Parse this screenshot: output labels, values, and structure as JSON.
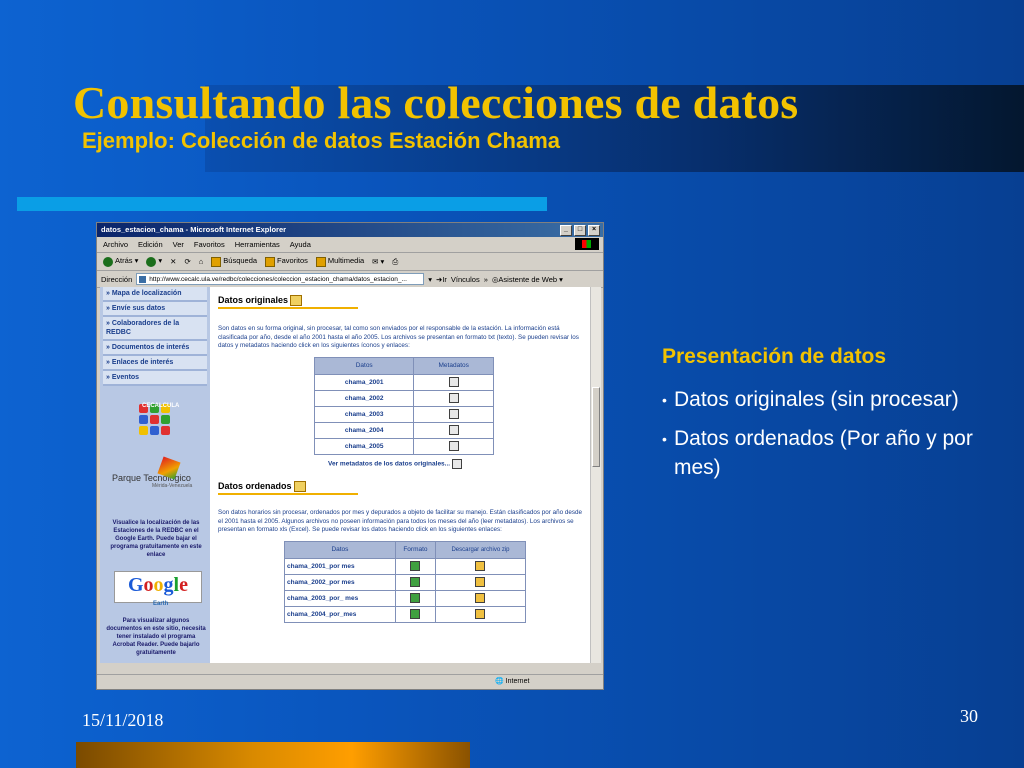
{
  "slide": {
    "title": "Consultando las colecciones de datos",
    "subtitle": "Ejemplo: Colección de datos Estación Chama",
    "date": "15/11/2018",
    "page_number": "30",
    "bullets_heading": "Presentación de datos",
    "bullets": [
      "Datos originales (sin procesar)",
      "Datos ordenados (Por año y por mes)"
    ],
    "colors": {
      "title": "#f2c200",
      "background": "#0a4fb0"
    }
  },
  "browser": {
    "window_title": "datos_estacion_chama - Microsoft Internet Explorer",
    "menu": [
      "Archivo",
      "Edición",
      "Ver",
      "Favoritos",
      "Herramientas",
      "Ayuda"
    ],
    "toolbar": {
      "back": "Atrás",
      "search": "Búsqueda",
      "favorites": "Favoritos",
      "multimedia": "Multimedia"
    },
    "address_label": "Dirección",
    "address": "http://www.cecalc.ula.ve/redbc/colecciones/coleccion_estacion_chama/datos_estacion_...",
    "go": "Ir",
    "links": "Vínculos",
    "web_assistant": "Asistente de Web",
    "status": "Internet"
  },
  "sidebar": {
    "items": [
      "Mapa de localización",
      "Envíe sus datos",
      "Colaboradores de la REDBC",
      "Documentos de interés",
      "Enlaces de interés",
      "Eventos"
    ],
    "logo_label": "CECALCULA",
    "park_name": "Parque Tecnológico",
    "park_sub": "Mérida-Venezuela",
    "google_earth_text": "Visualice la localización de las Estaciones de la REDBC en el Google Earth. Puede bajar el programa gratuitamente en este enlace",
    "google_earth_logo": "Google",
    "google_earth_sub": "Earth",
    "acrobat_text": "Para visualizar algunos documentos en este sitio, necesita tener instalado el programa Acrobat Reader. Puede bajarlo gratuitamente"
  },
  "content": {
    "originales": {
      "heading": "Datos originales",
      "text": "Son datos en su forma original, sin procesar, tal como son enviados por el responsable de la estación. La información está clasificada por año, desde el año 2001 hasta el año 2005. Los archivos se presentan en formato txt (texto). Se pueden revisar los datos y metadatos haciendo click en los siguientes íconos y enlaces:",
      "columns": [
        "Datos",
        "Metadatos"
      ],
      "rows": [
        "chama_2001",
        "chama_2002",
        "chama_2003",
        "chama_2004",
        "chama_2005"
      ],
      "metadata_link": "Ver metadatos de los datos originales..."
    },
    "ordenados": {
      "heading": "Datos ordenados",
      "text": "Son datos horarios sin procesar, ordenados por mes y depurados a objeto de facilitar su manejo. Están clasificados por año desde el 2001 hasta el 2005. Algunos archivos no poseen información para todos los meses del año (leer metadatos). Los archivos se presentan en formato xls (Excel). Se puede revisar los datos haciendo click en los siguientes enlaces:",
      "columns": [
        "Datos",
        "Formato",
        "Descargar archivo zip"
      ],
      "rows": [
        "chama_2001_por mes",
        "chama_2002_por mes",
        "chama_2003_por_ mes",
        "chama_2004_por_mes"
      ]
    }
  }
}
